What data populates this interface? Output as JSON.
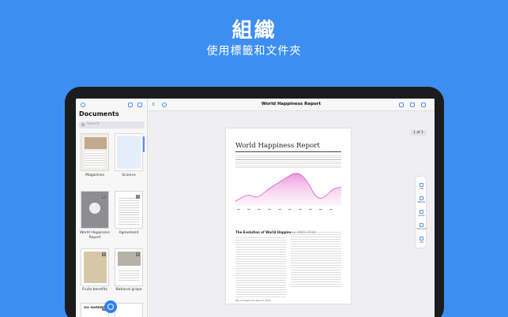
{
  "hero": {
    "title": "組織",
    "subtitle": "使用標籤和文件夾"
  },
  "sidebar": {
    "title": "Documents",
    "search_placeholder": "Search",
    "items": [
      {
        "label": "Magazines",
        "badge": ""
      },
      {
        "label": "Science",
        "badge": ""
      },
      {
        "label": "World Happiness Report",
        "badge": "1"
      },
      {
        "label": "Agreement",
        "badge": "1"
      },
      {
        "label": "Fruits benefits",
        "badge": "1"
      },
      {
        "label": "National grape",
        "badge": "1"
      },
      {
        "label": "OIL MARKET",
        "badge": "1"
      },
      {
        "label": "",
        "badge": ""
      }
    ],
    "accent_color": "#2f7ef6"
  },
  "document": {
    "toolbar_title": "World Happiness Report",
    "page_indicator": "1 of 1",
    "page": {
      "heading": "World Happiness Report",
      "section_heading": "The Evolution of World Happiness 2005-2018",
      "footer": "World Happiness Report 2019"
    },
    "tools": [
      "Add",
      "Markup",
      "e-sign",
      "Scan & Ill",
      "Add"
    ]
  },
  "background_color": "#3d8ef3"
}
